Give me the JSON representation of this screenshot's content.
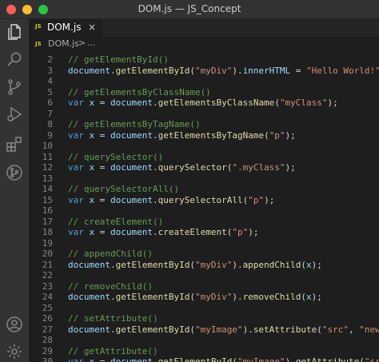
{
  "window": {
    "title": "DOM.js — JS_Concept"
  },
  "colors": {
    "close": "#ff5f57",
    "minimize": "#febc2e",
    "maximize": "#28c840",
    "comment": "#6a9955",
    "keyword": "#569cd6",
    "variable": "#9cdcfe",
    "function": "#dcdcaa",
    "string": "#ce9178"
  },
  "activity_bar": {
    "icons": [
      "files-icon",
      "search-icon",
      "source-control-icon",
      "run-debug-icon",
      "extensions-icon",
      "git-graph-icon",
      "account-icon",
      "settings-gear-icon"
    ]
  },
  "tab": {
    "type_badge": "JS",
    "name": "DOM.js",
    "close": "×"
  },
  "breadcrumb": {
    "type_badge": "JS",
    "file": "DOM.js",
    "separator": ">",
    "more": "..."
  },
  "editor": {
    "lines": [
      {
        "n": "2",
        "tokens": [
          [
            "c",
            "// getElementById()"
          ]
        ]
      },
      {
        "n": "3",
        "tokens": [
          [
            "v",
            "document"
          ],
          [
            "p",
            "."
          ],
          [
            "f",
            "getElementById"
          ],
          [
            "p",
            "("
          ],
          [
            "s",
            "\"myDiv\""
          ],
          [
            "p",
            ")."
          ],
          [
            "v",
            "innerHTML"
          ],
          [
            "p",
            " = "
          ],
          [
            "s",
            "\"Hello World!\""
          ],
          [
            "p",
            ";"
          ]
        ]
      },
      {
        "n": "4",
        "tokens": []
      },
      {
        "n": "5",
        "tokens": [
          [
            "c",
            "// getElementsByClassName()"
          ]
        ]
      },
      {
        "n": "6",
        "tokens": [
          [
            "k",
            "var"
          ],
          [
            "p",
            " "
          ],
          [
            "v",
            "x"
          ],
          [
            "p",
            " = "
          ],
          [
            "v",
            "document"
          ],
          [
            "p",
            "."
          ],
          [
            "f",
            "getElementsByClassName"
          ],
          [
            "p",
            "("
          ],
          [
            "s",
            "\"myClass\""
          ],
          [
            "p",
            ");"
          ]
        ]
      },
      {
        "n": "7",
        "tokens": []
      },
      {
        "n": "8",
        "tokens": [
          [
            "c",
            "// getElementsByTagName()"
          ]
        ]
      },
      {
        "n": "9",
        "tokens": [
          [
            "k",
            "var"
          ],
          [
            "p",
            " "
          ],
          [
            "v",
            "x"
          ],
          [
            "p",
            " = "
          ],
          [
            "v",
            "document"
          ],
          [
            "p",
            "."
          ],
          [
            "f",
            "getElementsByTagName"
          ],
          [
            "p",
            "("
          ],
          [
            "s",
            "\"p\""
          ],
          [
            "p",
            ");"
          ]
        ]
      },
      {
        "n": "10",
        "tokens": []
      },
      {
        "n": "11",
        "tokens": [
          [
            "c",
            "// querySelector()"
          ]
        ]
      },
      {
        "n": "12",
        "tokens": [
          [
            "k",
            "var"
          ],
          [
            "p",
            " "
          ],
          [
            "v",
            "x"
          ],
          [
            "p",
            " = "
          ],
          [
            "v",
            "document"
          ],
          [
            "p",
            "."
          ],
          [
            "f",
            "querySelector"
          ],
          [
            "p",
            "("
          ],
          [
            "s",
            "\".myClass\""
          ],
          [
            "p",
            ");"
          ]
        ]
      },
      {
        "n": "13",
        "tokens": []
      },
      {
        "n": "14",
        "tokens": [
          [
            "c",
            "// querySelectorAll()"
          ]
        ]
      },
      {
        "n": "15",
        "tokens": [
          [
            "k",
            "var"
          ],
          [
            "p",
            " "
          ],
          [
            "v",
            "x"
          ],
          [
            "p",
            " = "
          ],
          [
            "v",
            "document"
          ],
          [
            "p",
            "."
          ],
          [
            "f",
            "querySelectorAll"
          ],
          [
            "p",
            "("
          ],
          [
            "s",
            "\"p\""
          ],
          [
            "p",
            ");"
          ]
        ]
      },
      {
        "n": "16",
        "tokens": []
      },
      {
        "n": "17",
        "tokens": [
          [
            "c",
            "// createElement()"
          ]
        ]
      },
      {
        "n": "18",
        "tokens": [
          [
            "k",
            "var"
          ],
          [
            "p",
            " "
          ],
          [
            "v",
            "x"
          ],
          [
            "p",
            " = "
          ],
          [
            "v",
            "document"
          ],
          [
            "p",
            "."
          ],
          [
            "f",
            "createElement"
          ],
          [
            "p",
            "("
          ],
          [
            "s",
            "\"p\""
          ],
          [
            "p",
            ");"
          ]
        ]
      },
      {
        "n": "19",
        "tokens": []
      },
      {
        "n": "20",
        "tokens": [
          [
            "c",
            "// appendChild()"
          ]
        ]
      },
      {
        "n": "21",
        "tokens": [
          [
            "v",
            "document"
          ],
          [
            "p",
            "."
          ],
          [
            "f",
            "getElementById"
          ],
          [
            "p",
            "("
          ],
          [
            "s",
            "\"myDiv\""
          ],
          [
            "p",
            ")."
          ],
          [
            "f",
            "appendChild"
          ],
          [
            "p",
            "("
          ],
          [
            "v",
            "x"
          ],
          [
            "p",
            ");"
          ]
        ]
      },
      {
        "n": "22",
        "tokens": []
      },
      {
        "n": "23",
        "tokens": [
          [
            "c",
            "// removeChild()"
          ]
        ]
      },
      {
        "n": "24",
        "tokens": [
          [
            "v",
            "document"
          ],
          [
            "p",
            "."
          ],
          [
            "f",
            "getElementById"
          ],
          [
            "p",
            "("
          ],
          [
            "s",
            "\"myDiv\""
          ],
          [
            "p",
            ")."
          ],
          [
            "f",
            "removeChild"
          ],
          [
            "p",
            "("
          ],
          [
            "v",
            "x"
          ],
          [
            "p",
            ");"
          ]
        ]
      },
      {
        "n": "25",
        "tokens": []
      },
      {
        "n": "26",
        "tokens": [
          [
            "c",
            "// setAttribute()"
          ]
        ]
      },
      {
        "n": "27",
        "tokens": [
          [
            "v",
            "document"
          ],
          [
            "p",
            "."
          ],
          [
            "f",
            "getElementById"
          ],
          [
            "p",
            "("
          ],
          [
            "s",
            "\"myImage\""
          ],
          [
            "p",
            ")."
          ],
          [
            "f",
            "setAttribute"
          ],
          [
            "p",
            "("
          ],
          [
            "s",
            "\"src\""
          ],
          [
            "p",
            ", "
          ],
          [
            "s",
            "\"newimage.jpg\""
          ],
          [
            "p",
            ");"
          ]
        ]
      },
      {
        "n": "28",
        "tokens": []
      },
      {
        "n": "29",
        "tokens": [
          [
            "c",
            "// getAttribute()"
          ]
        ]
      },
      {
        "n": "30",
        "tokens": [
          [
            "k",
            "var"
          ],
          [
            "p",
            " "
          ],
          [
            "v",
            "x"
          ],
          [
            "p",
            " = "
          ],
          [
            "v",
            "document"
          ],
          [
            "p",
            "."
          ],
          [
            "f",
            "getElementById"
          ],
          [
            "p",
            "("
          ],
          [
            "s",
            "\"myImage\""
          ],
          [
            "p",
            ")."
          ],
          [
            "f",
            "getAttribute"
          ],
          [
            "p",
            "("
          ],
          [
            "s",
            "\"src\""
          ],
          [
            "p",
            ");"
          ]
        ]
      }
    ]
  }
}
